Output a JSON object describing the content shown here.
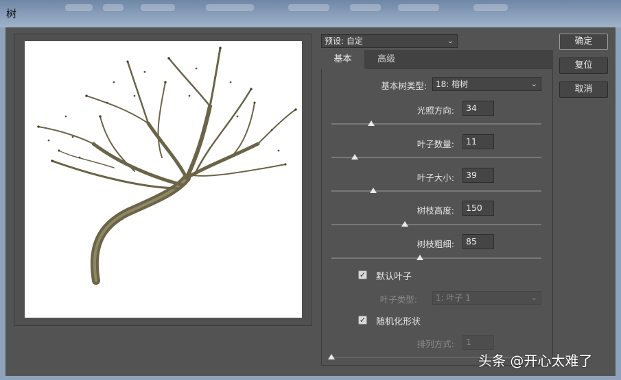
{
  "window": {
    "title": "树"
  },
  "preset": {
    "value": "预设: 自定"
  },
  "tabs": [
    {
      "label": "基本",
      "active": true
    },
    {
      "label": "高级",
      "active": false
    }
  ],
  "tree_type": {
    "label": "基本树类型:",
    "value": "18: 榕树"
  },
  "sliders": [
    {
      "label": "光照方向:",
      "value": "34",
      "level": 0.19
    },
    {
      "label": "叶子数量:",
      "value": "11",
      "level": 0.11
    },
    {
      "label": "叶子大小:",
      "value": "39",
      "level": 0.2
    },
    {
      "label": "树枝高度:",
      "value": "150",
      "level": 0.35
    },
    {
      "label": "树枝粗细:",
      "value": "85",
      "level": 0.42
    }
  ],
  "default_leaves": {
    "label": "默认叶子",
    "checked": true
  },
  "leaf_type": {
    "label": "叶子类型:",
    "value": "1: 叶子 1"
  },
  "randomize": {
    "label": "随机化形状",
    "checked": true
  },
  "arrangement": {
    "label": "排列方式:",
    "value": "1",
    "level": 0.0
  },
  "buttons": {
    "ok": "确定",
    "reset": "复位",
    "cancel": "取消"
  },
  "watermark": "头条 @开心太难了",
  "colors": {
    "dialog_bg": "#535353",
    "tree_trunk": "#6b6448",
    "canvas_bg": "#ffffff"
  }
}
